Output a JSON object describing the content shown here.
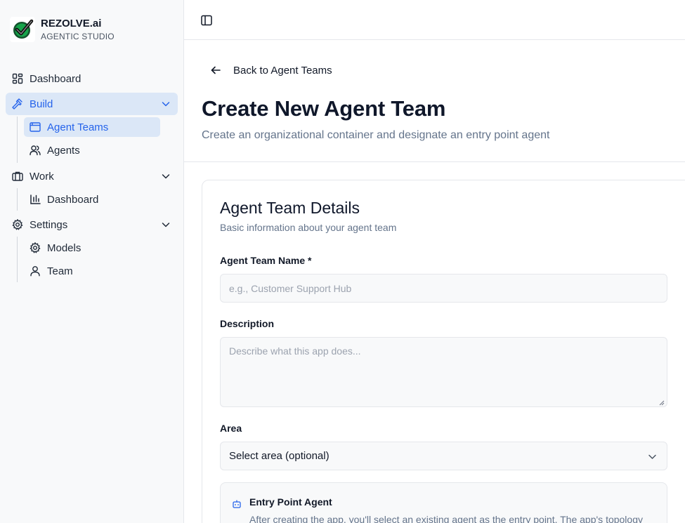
{
  "brand": {
    "name": "REZOLVE.ai",
    "subtitle": "AGENTIC STUDIO"
  },
  "sidebar": {
    "dashboard": {
      "label": "Dashboard",
      "icon": "grid-icon"
    },
    "build": {
      "label": "Build",
      "icon": "hammer-icon",
      "expanded": true,
      "items": [
        {
          "label": "Agent Teams",
          "icon": "window-icon",
          "active": true
        },
        {
          "label": "Agents",
          "icon": "users-icon"
        }
      ]
    },
    "work": {
      "label": "Work",
      "icon": "briefcase-icon",
      "expanded": true,
      "items": [
        {
          "label": "Dashboard",
          "icon": "bar-chart-icon"
        }
      ]
    },
    "settings": {
      "label": "Settings",
      "icon": "gear-icon",
      "expanded": true,
      "items": [
        {
          "label": "Models",
          "icon": "gear-icon"
        },
        {
          "label": "Team",
          "icon": "user-icon"
        }
      ]
    }
  },
  "header": {
    "back_label": "Back to Agent Teams",
    "title": "Create New Agent Team",
    "subtitle": "Create an organizational container and designate an entry point agent"
  },
  "form": {
    "card_title": "Agent Team Details",
    "card_desc": "Basic information about your agent team",
    "name_label": "Agent Team Name *",
    "name_placeholder": "e.g., Customer Support Hub",
    "description_label": "Description",
    "description_placeholder": "Describe what this app does...",
    "area_label": "Area",
    "area_value": "Select area (optional)",
    "entry_title": "Entry Point Agent",
    "entry_text": "After creating the app, you'll select an existing agent as the entry point. The app's topology"
  },
  "colors": {
    "accent": "#2563eb",
    "active_bg": "#dbe7f7",
    "sidebar_bg": "#f8f9fa"
  }
}
